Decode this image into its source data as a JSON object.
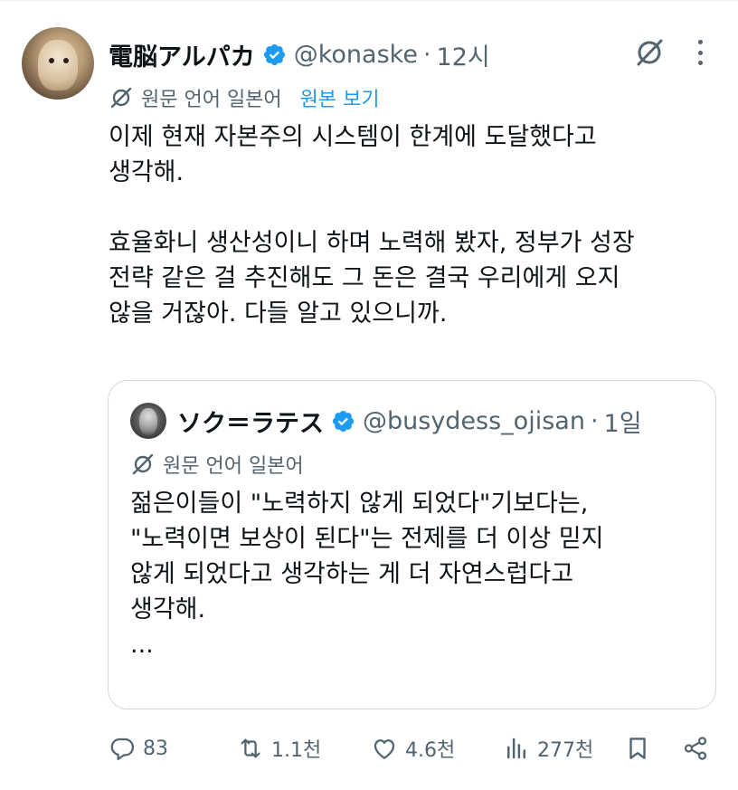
{
  "tweet": {
    "author": {
      "display_name": "電脳アルパカ",
      "handle": "@konaske",
      "verified": true
    },
    "separator": "·",
    "time": "12시",
    "translation": {
      "label": "원문 언어 일본어",
      "show_original": "원본 보기"
    },
    "body": {
      "paragraph1_line1": "이제 현재 자본주의 시스템이 한계에 도달했다고",
      "paragraph1_line2": "생각해.",
      "paragraph2_line1": "효율화니 생산성이니 하며 노력해 봤자, 정부가 성장",
      "paragraph2_line2": "전략 같은 걸 추진해도 그 돈은 결국 우리에게 오지",
      "paragraph2_line3": "않을 거잖아. 다들 알고 있으니까."
    },
    "quote": {
      "author": {
        "display_name": "ソク＝ラテス",
        "handle": "@busydess_ojisan",
        "verified": true
      },
      "separator": "·",
      "time": "1일",
      "translation_label": "원문 언어 일본어",
      "body": {
        "line1": "젊은이들이 \"노력하지 않게 되었다\"기보다는,",
        "line2": "\"노력이면 보상이 된다\"는 전제를 더 이상 믿지",
        "line3": "않게 되었다고 생각하는 게 더 자연스럽다고",
        "line4": "생각해.",
        "line5": "..."
      }
    },
    "actions": {
      "replies": "83",
      "reposts": "1.1천",
      "likes": "4.6천",
      "views": "277천"
    }
  },
  "colors": {
    "text_primary": "#0f1419",
    "text_secondary": "#536471",
    "accent_blue": "#1d9bf0",
    "border": "#cfd9de"
  },
  "icons": {
    "verified": "verified-badge-icon",
    "grok": "grok-icon",
    "more": "more-icon",
    "translate": "translate-icon",
    "reply": "reply-icon",
    "repost": "repost-icon",
    "like": "heart-icon",
    "views": "views-icon",
    "bookmark": "bookmark-icon",
    "share": "share-icon"
  }
}
